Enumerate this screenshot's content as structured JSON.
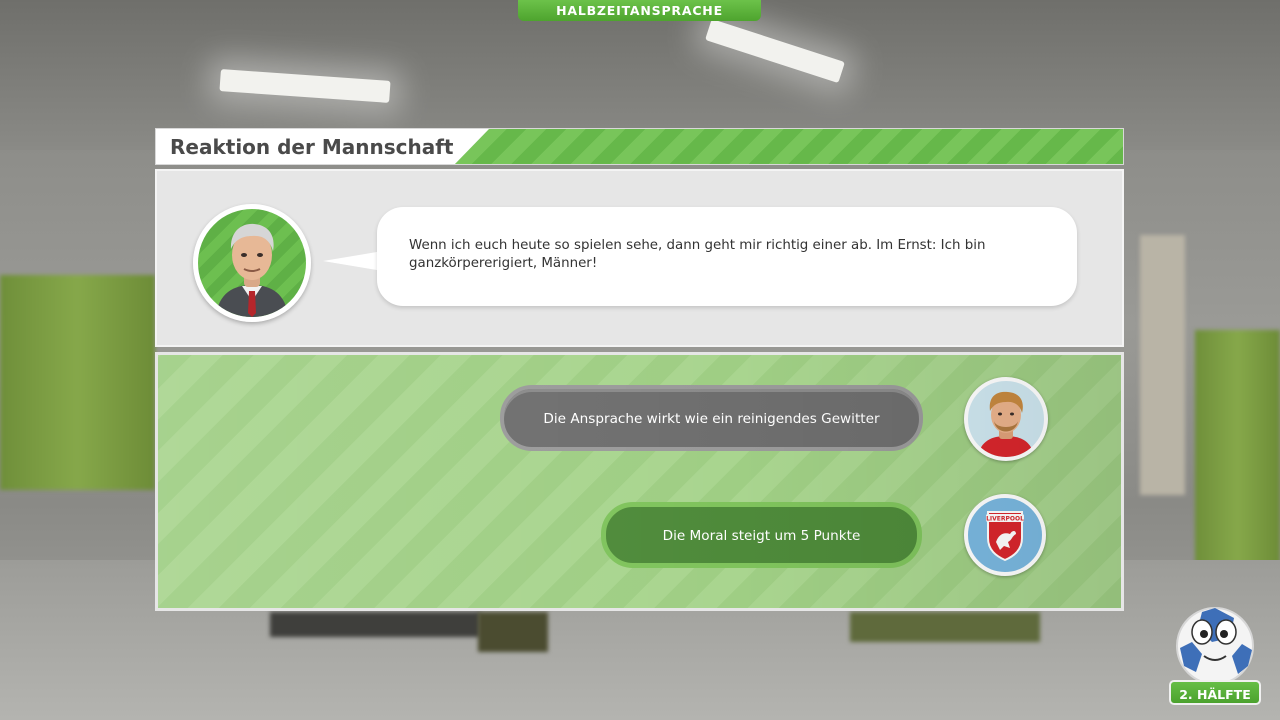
{
  "top_banner": {
    "label": "HALBZEITANSPRACHE"
  },
  "panel": {
    "title": "Reaktion der Mannschaft",
    "coach_speech": "Wenn ich euch heute so spielen sehe, dann geht mir richtig einer ab. Im Ernst: Ich bin ganzkörpererigiert, Männer!",
    "reactions": [
      {
        "text": "Die Ansprache wirkt wie ein reinigendes Gewitter",
        "style": "gray",
        "icon": "player-portrait"
      },
      {
        "text": "Die Moral steigt um 5 Punkte",
        "style": "green",
        "icon": "club-crest",
        "crest_text": "LIVERPOOL"
      }
    ]
  },
  "bottom_right": {
    "button_label": "2. HÄLFTE",
    "icon": "ball-mascot"
  },
  "colors": {
    "accent_green": "#5fb046",
    "pill_gray": "#6e6e6e",
    "pill_green": "#4e8a3a",
    "crest_red": "#d9262c"
  }
}
